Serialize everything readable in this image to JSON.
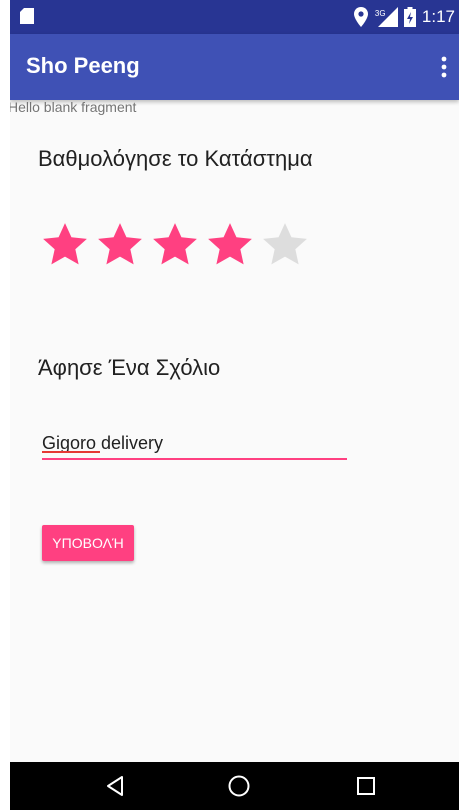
{
  "status_bar": {
    "time": "1:17",
    "network_type": "3G",
    "icons": [
      "sd-card-icon",
      "location-icon",
      "signal-icon",
      "battery-icon"
    ]
  },
  "app_bar": {
    "title": "Sho Peeng",
    "menu_icon": "overflow-menu-icon"
  },
  "fragment": {
    "hello_text": "Hello blank fragment"
  },
  "rating": {
    "heading": "Βαθμολόγησε το Κατάστημα",
    "value": 4,
    "max": 5,
    "filled_color": "#ff4081",
    "empty_color": "#dddddd"
  },
  "comment": {
    "heading": "Άφησε Ένα Σχόλιο",
    "value": "Gigoro delivery"
  },
  "submit": {
    "label": "ΥΠΟΒΟΛΉ"
  },
  "nav_bar": {
    "icons": [
      "back-icon",
      "home-icon",
      "recents-icon"
    ]
  },
  "colors": {
    "primary": "#3f51b5",
    "primary_dark": "#283593",
    "accent": "#ff4081"
  }
}
